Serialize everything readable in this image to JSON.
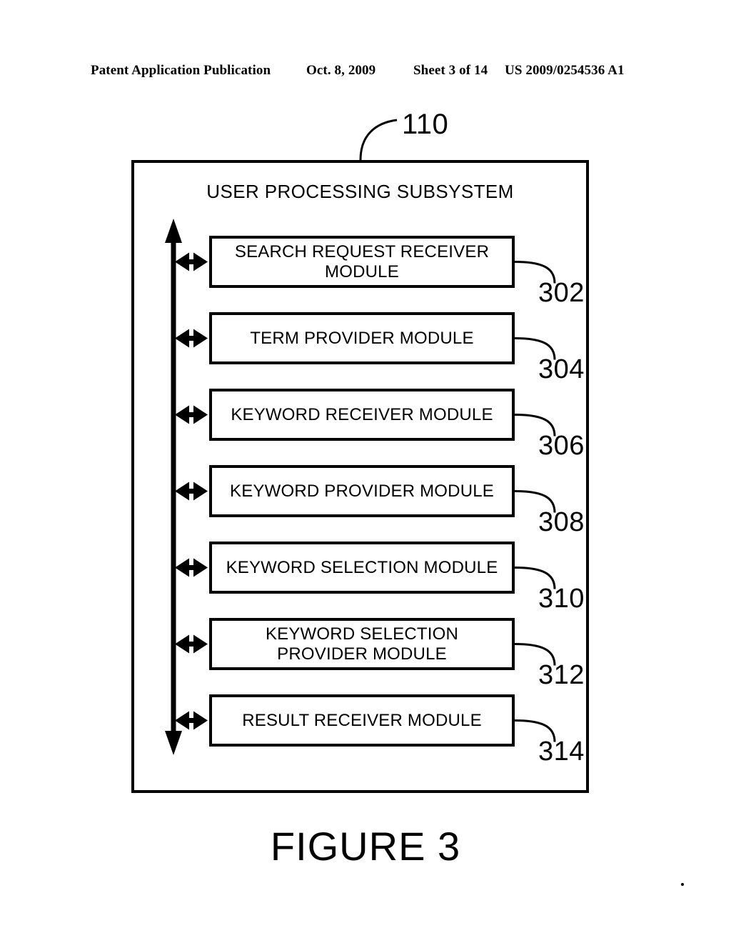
{
  "header": {
    "publication": "Patent Application Publication",
    "date": "Oct. 8, 2009",
    "sheet": "Sheet 3 of 14",
    "patent_number": "US 2009/0254536 A1"
  },
  "figure": {
    "caption": "FIGURE 3",
    "system_reference": "110",
    "title": "USER PROCESSING SUBSYSTEM",
    "modules": [
      {
        "label": "SEARCH REQUEST RECEIVER\nMODULE",
        "ref": "302"
      },
      {
        "label": "TERM PROVIDER MODULE",
        "ref": "304"
      },
      {
        "label": "KEYWORD RECEIVER MODULE",
        "ref": "306"
      },
      {
        "label": "KEYWORD PROVIDER MODULE",
        "ref": "308"
      },
      {
        "label": "KEYWORD SELECTION MODULE",
        "ref": "310"
      },
      {
        "label": "KEYWORD SELECTION\nPROVIDER MODULE",
        "ref": "312"
      },
      {
        "label": "RESULT RECEIVER MODULE",
        "ref": "314"
      }
    ],
    "bus": {
      "name": "vertical-bidirectional-bus",
      "connector_count": 7
    }
  },
  "colors": {
    "ink": "#000000",
    "paper": "#ffffff"
  }
}
